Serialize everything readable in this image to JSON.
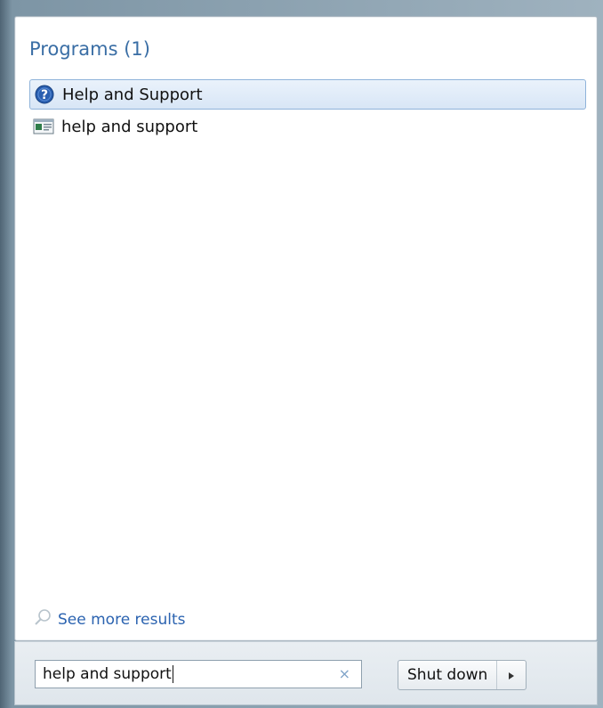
{
  "results": {
    "section_title": "Programs (1)",
    "items": [
      {
        "label": "Help and Support",
        "icon": "help-icon",
        "selected": true
      },
      {
        "label": "help and support",
        "icon": "window-icon",
        "selected": false
      }
    ]
  },
  "see_more": {
    "label": "See more results",
    "icon": "search-icon"
  },
  "search": {
    "value": "help and support",
    "clear_icon": "×"
  },
  "shutdown": {
    "label": "Shut down",
    "arrow_icon": "play-arrow-icon"
  },
  "colors": {
    "accent": "#3a6ea5",
    "link": "#2b63b0",
    "selection_bg": "#d8e6f6",
    "selection_border": "#8fb3da"
  }
}
